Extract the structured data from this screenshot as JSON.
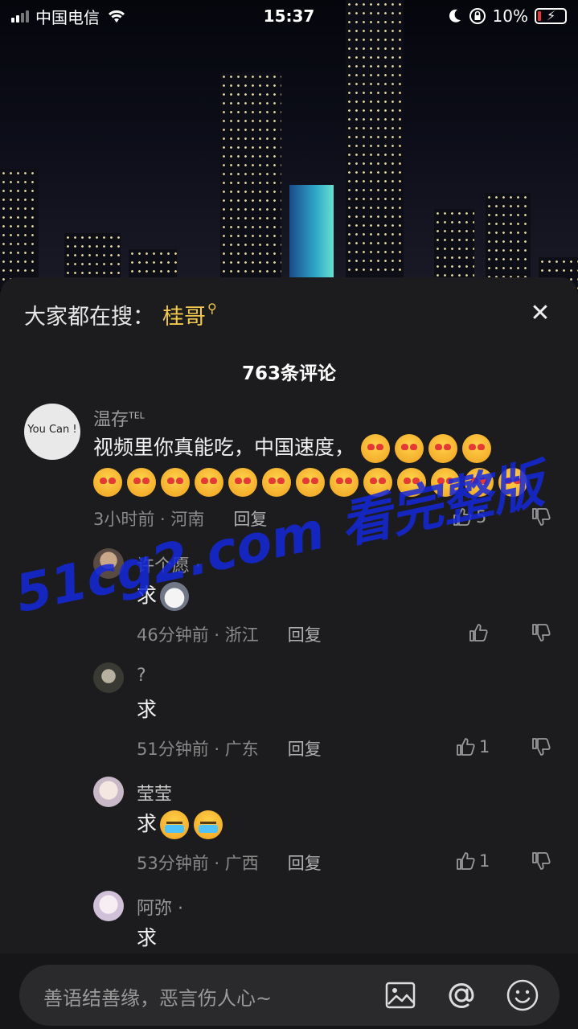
{
  "status_bar": {
    "carrier": "中国电信",
    "time": "15:37",
    "battery": "10%"
  },
  "sheet": {
    "search_prefix": "大家都在搜：",
    "search_term": "桂哥",
    "comment_count": "763条评论"
  },
  "comments": [
    {
      "user": "温存",
      "user_badge": "TEL",
      "avatar_text": "You Can !",
      "text": "视频里你真能吃，中国速度，",
      "time_loc": "3小时前 · 河南",
      "reply": "回复",
      "likes": "5"
    }
  ],
  "replies": [
    {
      "user": "许个愿 ·",
      "text": "求",
      "time_loc": "46分钟前 · 浙江",
      "reply": "回复",
      "likes": ""
    },
    {
      "user": "?",
      "text": "求",
      "time_loc": "51分钟前 · 广东",
      "reply": "回复",
      "likes": "1"
    },
    {
      "user": "莹莹",
      "text": "求",
      "time_loc": "53分钟前 · 广西",
      "reply": "回复",
      "likes": "1"
    },
    {
      "user": "阿弥 ·",
      "text": "求",
      "time_loc": "",
      "reply": "",
      "likes": ""
    }
  ],
  "watermark": "51cg2.com 看完整版",
  "input": {
    "placeholder": "善语结善缘，恶言伤人心~"
  },
  "icons": [
    "signal-icon",
    "wifi-icon",
    "moon-icon",
    "lock-rotation-icon",
    "battery-icon",
    "search-icon",
    "close-icon",
    "like-icon",
    "dislike-icon",
    "image-icon",
    "at-icon",
    "emoji-icon"
  ]
}
